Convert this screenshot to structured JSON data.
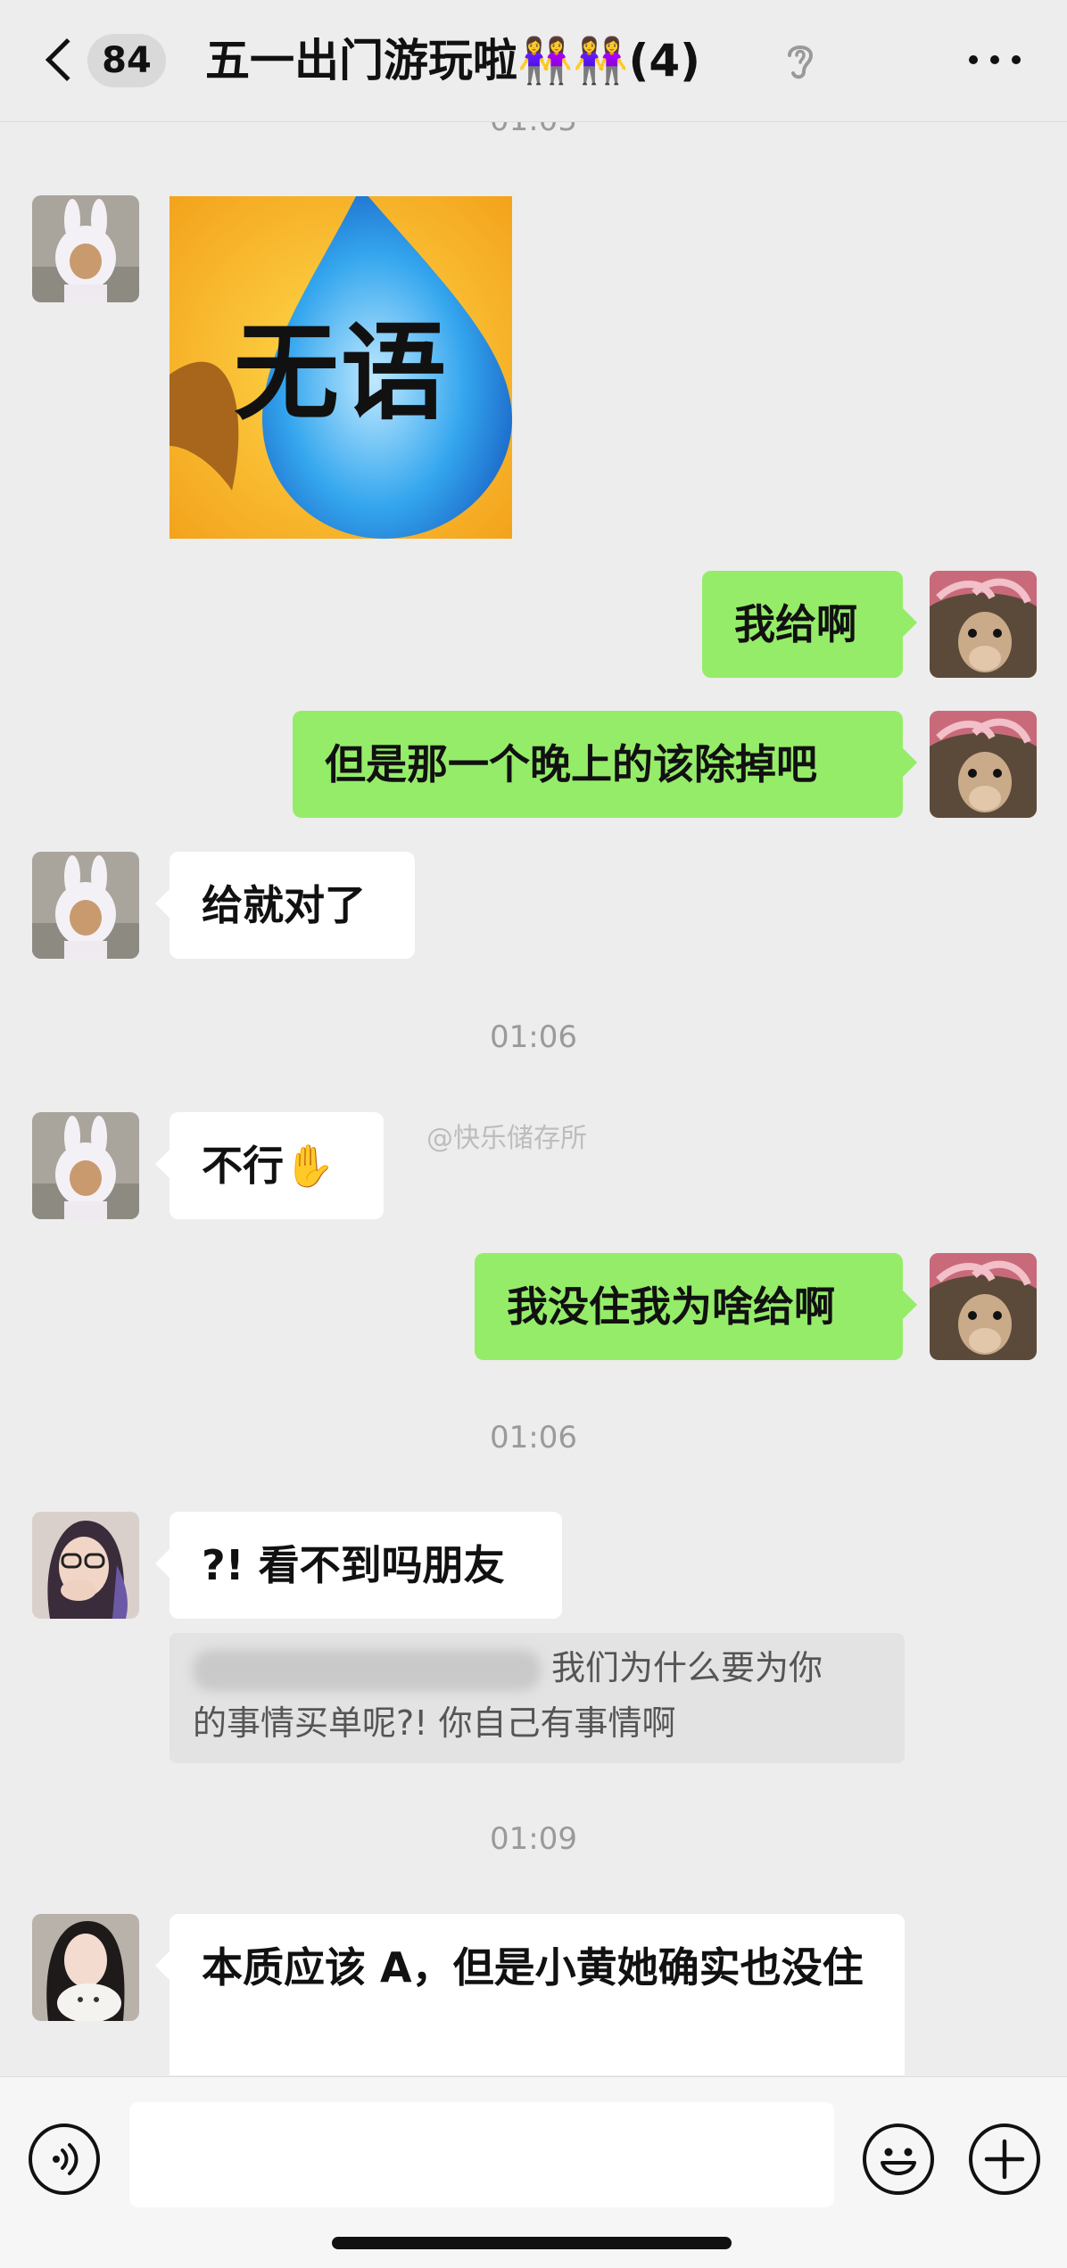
{
  "header": {
    "unread_count": "84",
    "title": "五一出门游玩啦👭👭",
    "member_count": "(4)"
  },
  "chat": {
    "time_top_partial": "01:05",
    "sticker_text": "无语",
    "msg_out_1": "我给啊",
    "msg_out_2": "但是那一个晚上的该除掉吧",
    "msg_in_1": "给就对了",
    "time_1": "01:06",
    "msg_in_2": "不行✋",
    "watermark": "@快乐储存所",
    "msg_out_3": "我没住我为啥给啊",
    "time_2": "01:06",
    "msg_in_3": "?! 看不到吗朋友",
    "quote_line_1": "我们为什么要为你",
    "quote_line_2": "的事情买单呢?! 你自己有事情啊",
    "time_3": "01:09",
    "msg_in_4": "本质应该 A，但是小黄她确实也没住"
  },
  "icons": {
    "back": "chevron-left-icon",
    "mute": "ear-icon",
    "more": "ellipsis-icon",
    "voice": "voice-icon",
    "emoji": "smiley-icon",
    "plus": "plus-icon"
  },
  "colors": {
    "background": "#ededed",
    "bubble_out": "#95ec69",
    "bubble_in": "#ffffff"
  }
}
